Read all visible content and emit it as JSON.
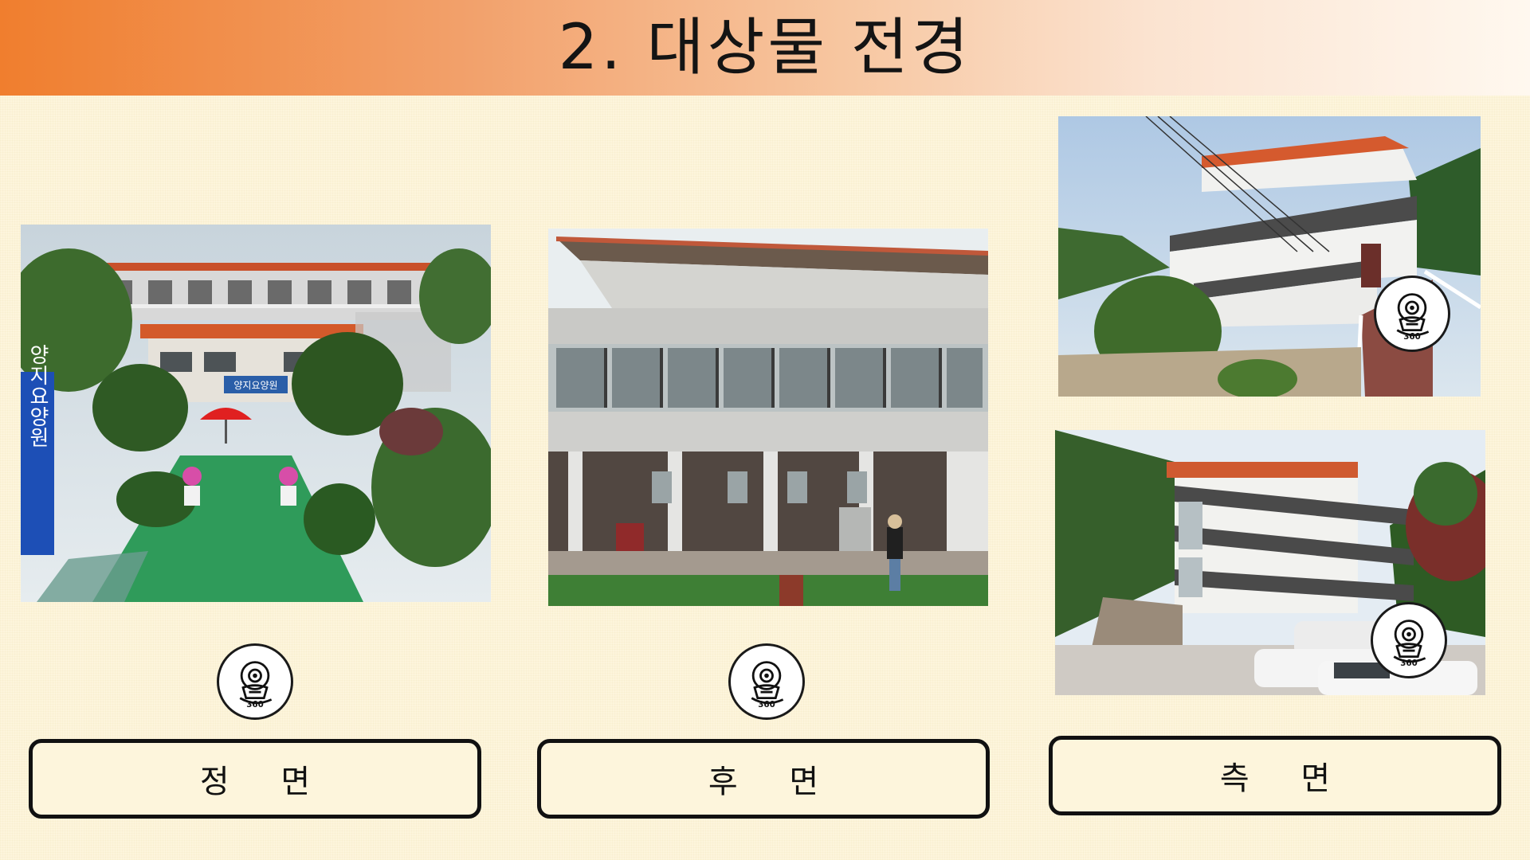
{
  "page": {
    "title": "2. 대상물 전경"
  },
  "cards": [
    {
      "id": "front",
      "label": "정 면",
      "icon": "camera-360-icon"
    },
    {
      "id": "rear",
      "label": "후 면",
      "icon": "camera-360-icon"
    },
    {
      "id": "side",
      "label": "측 면",
      "icon": "camera-360-icon"
    }
  ],
  "photos": {
    "front": {
      "sign_text": "양지요양원",
      "board_text": "양지요양원"
    }
  },
  "icon_text": "360",
  "colors": {
    "title_gradient_start": "#f07e2e",
    "title_gradient_end": "#fff8ef",
    "background": "#fdf5dc",
    "border": "#111111",
    "roof": "#d9542a"
  }
}
